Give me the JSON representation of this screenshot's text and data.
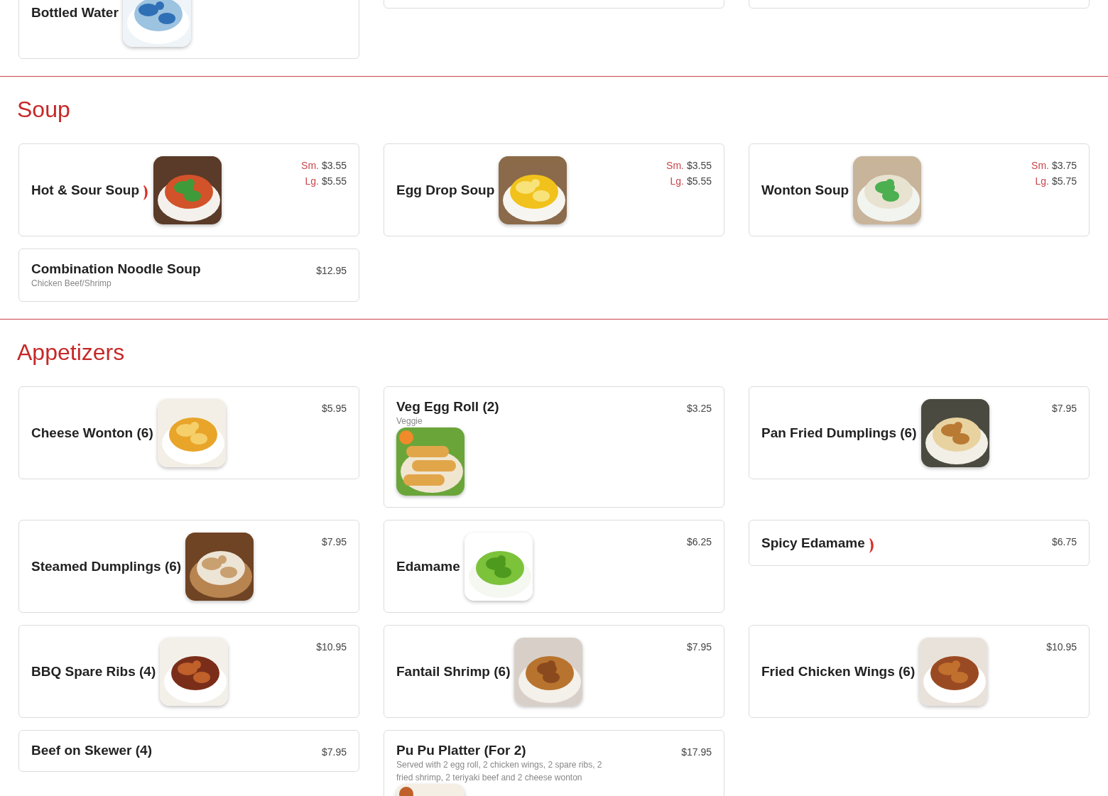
{
  "sections": [
    {
      "items": [
        {
          "kind": "dish",
          "name": "Bottled Water",
          "spicy": false,
          "image": {
            "kind": "picture"
          }
        },
        {
          "kind": "blank"
        },
        {
          "kind": "blank"
        }
      ]
    },
    {
      "title": "Soup",
      "items": [
        {
          "kind": "dish",
          "name": "Hot & Sour Soup",
          "spicy": true,
          "image": {
            "kind": "picture"
          },
          "prices": [
            {
              "size": "Sm.",
              "amount": "$3.55"
            },
            {
              "size": "Lg.",
              "amount": "$5.55"
            }
          ]
        },
        {
          "kind": "dish",
          "name": "Egg Drop Soup",
          "spicy": false,
          "image": {
            "kind": "picture"
          },
          "prices": [
            {
              "size": "Sm.",
              "amount": "$3.55"
            },
            {
              "size": "Lg.",
              "amount": "$5.55"
            }
          ]
        },
        {
          "kind": "dish",
          "name": "Wonton Soup",
          "spicy": false,
          "image": {
            "kind": "picture"
          },
          "prices": [
            {
              "size": "Sm.",
              "amount": "$3.75"
            },
            {
              "size": "Lg.",
              "amount": "$5.75"
            }
          ]
        },
        {
          "kind": "dish",
          "name": "Combination Noodle Soup",
          "spicy": false,
          "description": "Chicken Beef/Shrimp",
          "prices": [
            {
              "amount": "$12.95"
            }
          ]
        }
      ]
    },
    {
      "title": "Appetizers",
      "items": [
        {
          "kind": "dish",
          "name": "Cheese Wonton (6)",
          "spicy": false,
          "image": {
            "kind": "picture"
          },
          "prices": [
            {
              "amount": "$5.95"
            }
          ]
        },
        {
          "kind": "dish",
          "name": "Veg Egg Roll (2)",
          "spicy": false,
          "description": "Veggie",
          "image": {
            "kind": "picture"
          },
          "prices": [
            {
              "amount": "$3.25"
            }
          ]
        },
        {
          "kind": "dish",
          "name": "Pan Fried Dumplings (6)",
          "spicy": false,
          "image": {
            "kind": "picture"
          },
          "prices": [
            {
              "amount": "$7.95"
            }
          ]
        },
        {
          "kind": "dish",
          "name": "Steamed Dumplings (6)",
          "spicy": false,
          "image": {
            "kind": "picture"
          },
          "prices": [
            {
              "amount": "$7.95"
            }
          ]
        },
        {
          "kind": "dish",
          "name": "Edamame",
          "spicy": false,
          "image": {
            "kind": "picture"
          },
          "prices": [
            {
              "amount": "$6.25"
            }
          ]
        },
        {
          "kind": "dish",
          "name": "Spicy Edamame",
          "spicy": true,
          "prices": [
            {
              "amount": "$6.75"
            }
          ]
        },
        {
          "kind": "dish",
          "name": "BBQ Spare Ribs (4)",
          "spicy": false,
          "image": {
            "kind": "picture"
          },
          "prices": [
            {
              "amount": "$10.95"
            }
          ]
        },
        {
          "kind": "dish",
          "name": "Fantail Shrimp (6)",
          "spicy": false,
          "image": {
            "kind": "picture"
          },
          "prices": [
            {
              "amount": "$7.95"
            }
          ]
        },
        {
          "kind": "dish",
          "name": "Fried Chicken Wings (6)",
          "spicy": false,
          "image": {
            "kind": "picture"
          },
          "prices": [
            {
              "amount": "$10.95"
            }
          ]
        },
        {
          "kind": "dish",
          "name": "Beef on Skewer (4)",
          "spicy": false,
          "prices": [
            {
              "amount": "$7.95"
            }
          ]
        },
        {
          "kind": "dish",
          "name": "Pu Pu Platter (For 2)",
          "spicy": false,
          "description": "Served with 2 egg roll, 2 chicken wings, 2 spare ribs, 2 fried shrimp, 2 teriyaki beef and 2 cheese wonton",
          "image": {
            "kind": "picture"
          },
          "prices": [
            {
              "amount": "$17.95"
            }
          ]
        }
      ]
    }
  ]
}
